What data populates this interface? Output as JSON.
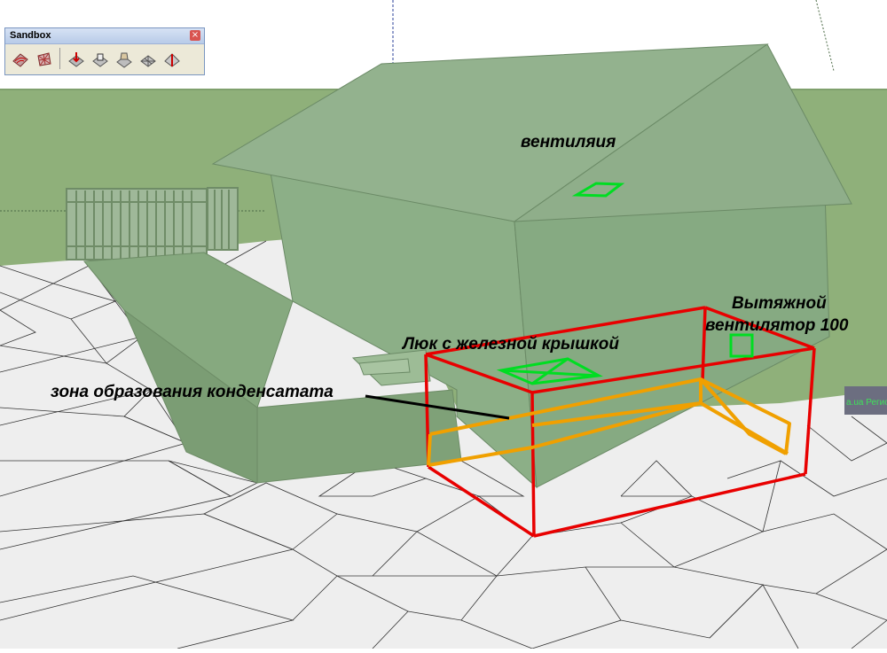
{
  "toolbar": {
    "title": "Sandbox",
    "close_label": "×",
    "tools": [
      {
        "name": "from-contours-tool-icon"
      },
      {
        "name": "from-scratch-tool-icon"
      },
      {
        "name": "smoove-tool-icon"
      },
      {
        "name": "stamp-tool-icon"
      },
      {
        "name": "drape-tool-icon"
      },
      {
        "name": "add-detail-tool-icon"
      },
      {
        "name": "flip-edge-tool-icon"
      }
    ]
  },
  "annotations": {
    "ventilation": "вентиляия",
    "exhaust_fan_line1": "Вытяжной",
    "exhaust_fan_line2": "вентилятор 100",
    "hatch": "Люк с железной крышкой",
    "condensate_zone": "зона образования конденсатата"
  },
  "region_tag": "a.ua Регио",
  "colors": {
    "sky": "#ffffff",
    "ground": "#8fb07a",
    "house": "#8fb08a",
    "terrain": "#f0f0f0",
    "box_outline": "#e80000",
    "duct": "#f0a000",
    "vent_marker": "#00dd22"
  }
}
